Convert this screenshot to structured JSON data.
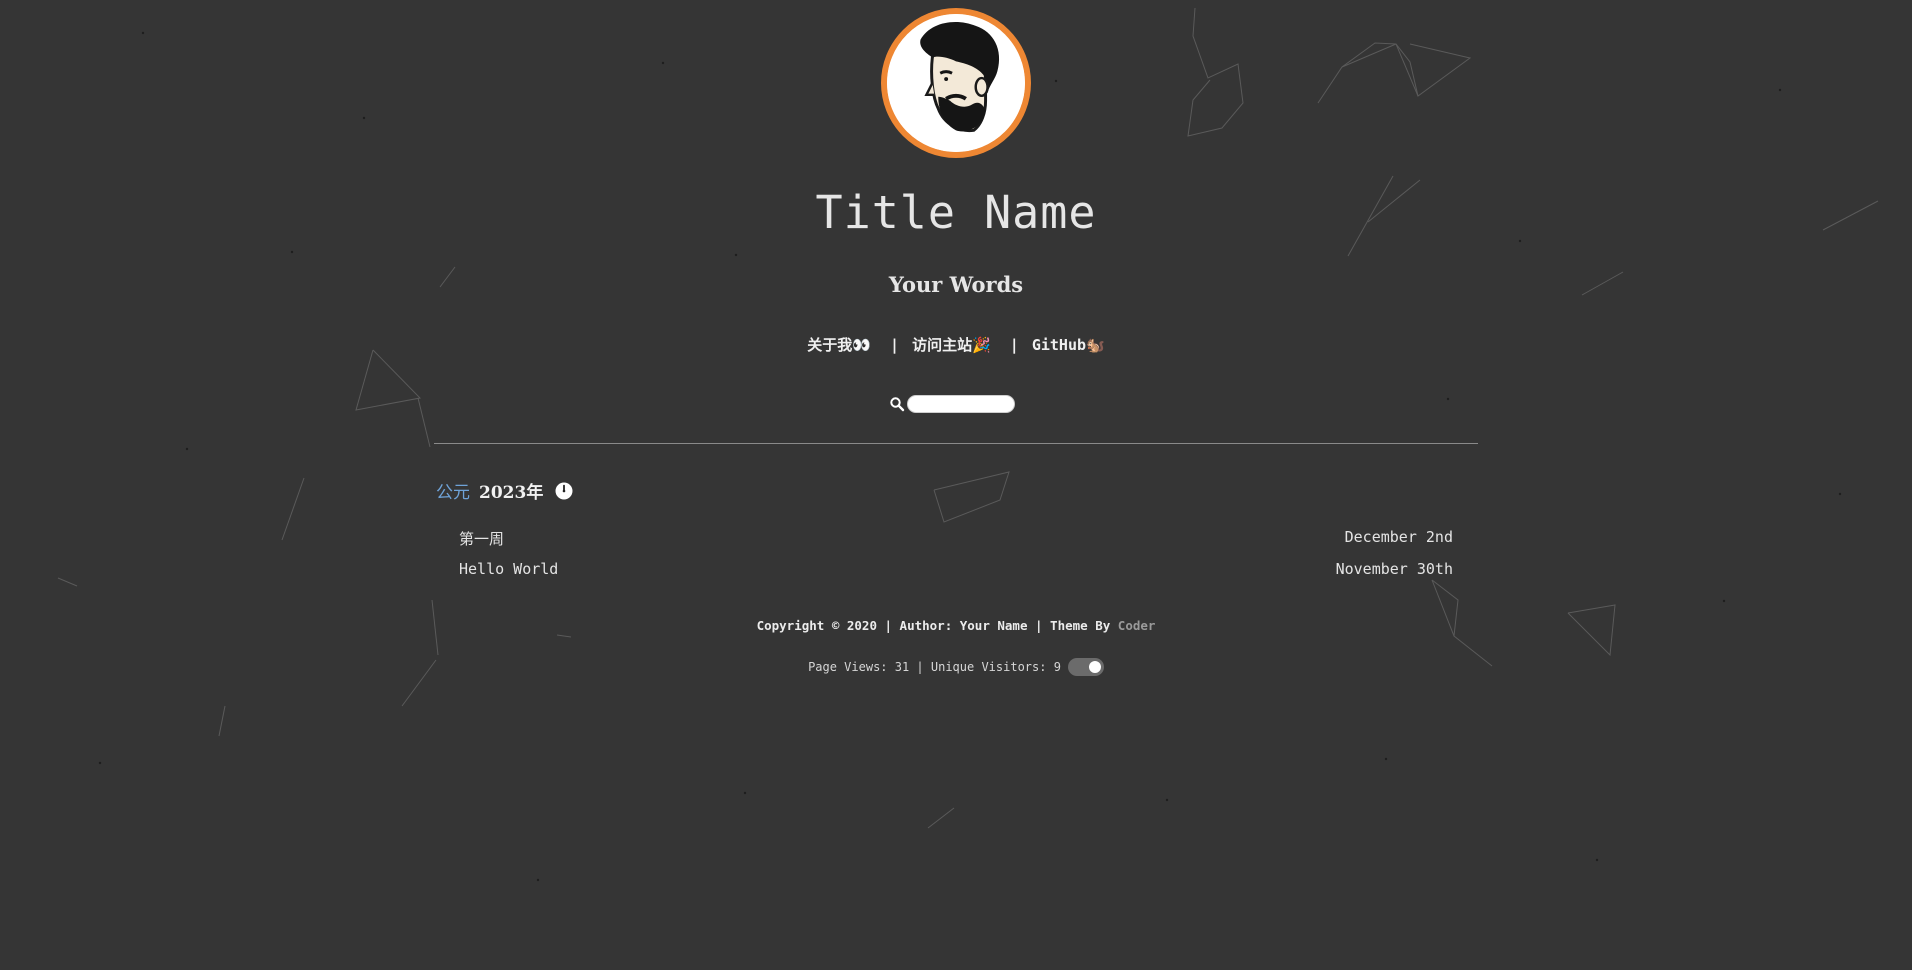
{
  "header": {
    "title": "Title Name",
    "subtitle": "Your Words",
    "avatar_icon": "bearded-man-avatar"
  },
  "nav": {
    "items": [
      {
        "label": "关于我👀"
      },
      {
        "label": "访问主站🎉"
      },
      {
        "label": "GitHub🐿️"
      }
    ],
    "separator": "|"
  },
  "search": {
    "icon": "search-icon",
    "value": "",
    "placeholder": ""
  },
  "archive": {
    "era": "公元",
    "year": "2023年",
    "year_icon": "clock-icon",
    "posts": [
      {
        "title": "第一周",
        "date": "December 2nd"
      },
      {
        "title": "Hello World",
        "date": "November 30th"
      }
    ]
  },
  "footer": {
    "copyright": "Copyright © 2020 | Author: Your Name | Theme By ",
    "theme_link": "Coder",
    "stats": "Page Views: 31 | Unique Visitors: 9",
    "toggle_on": true
  },
  "colors": {
    "background": "#353535",
    "avatar_ring": "#ee8733",
    "era_accent": "#6fa3d8",
    "theme_link": "#9a9a9a",
    "toggle_track": "#6b6b6b"
  }
}
